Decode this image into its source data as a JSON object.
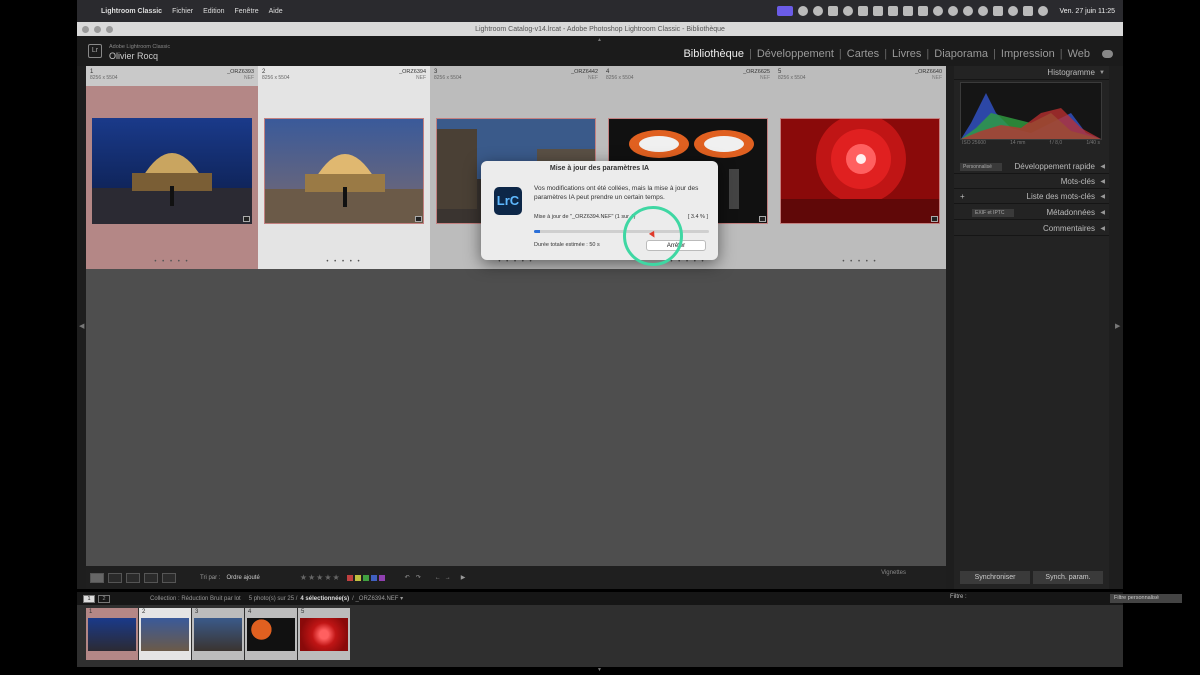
{
  "menubar": {
    "app_name": "Lightroom Classic",
    "menus": [
      "Fichier",
      "Edition",
      "Fenêtre",
      "Aide"
    ],
    "clock": "Ven. 27 juin 11:25"
  },
  "window": {
    "title": "Lightroom Catalog-v14.lrcat - Adobe Photoshop Lightroom Classic - Bibliothèque"
  },
  "header": {
    "logo": "Lr",
    "product": "Adobe Lightroom Classic",
    "user": "Olivier Rocq",
    "modules": [
      "Bibliothèque",
      "Développement",
      "Cartes",
      "Livres",
      "Diaporama",
      "Impression",
      "Web"
    ],
    "active_module": "Bibliothèque"
  },
  "grid": {
    "cells": [
      {
        "index": "1",
        "dims": "8256 x 5504",
        "filename": "_ORZ6393",
        "ext": "NEF",
        "dots": "• • • • •"
      },
      {
        "index": "2",
        "dims": "8256 x 5504",
        "filename": "_ORZ6394",
        "ext": "NEF",
        "dots": "• • • • •"
      },
      {
        "index": "3",
        "dims": "8256 x 5504",
        "filename": "_ORZ6442",
        "ext": "NEF",
        "dots": "• • • • •"
      },
      {
        "index": "4",
        "dims": "8256 x 5504",
        "filename": "_ORZ6625",
        "ext": "NEF",
        "dots": "• • • • •"
      },
      {
        "index": "5",
        "dims": "8256 x 5504",
        "filename": "_ORZ6640",
        "ext": "NEF",
        "dots": "• • • • •"
      }
    ]
  },
  "dialog": {
    "title": "Mise à jour des paramètres IA",
    "logo": "LrC",
    "message": "Vos modifications ont été collées, mais la mise à jour des paramètres IA peut prendre un certain temps.",
    "progress_label": "Mise à jour de \"_ORZ6394.NEF\" (1 sur 4)",
    "progress_pct": "[ 3.4 % ]",
    "progress_value": 0.034,
    "duration": "Durée totale estimée : 50 s",
    "stop_button": "Arrêter"
  },
  "toolbar": {
    "sort_label": "Tri par :",
    "sort_value": "Ordre ajouté",
    "stars": "★★★★★",
    "vignettes_label": "Vignettes"
  },
  "right_panel": {
    "histogram": "Histogramme",
    "histo_info": [
      "ISO 25600",
      "14 mm",
      "f / 8,0",
      "1/40 s"
    ],
    "quick_dev_preset": "Personnalisé",
    "quick_dev": "Développement rapide",
    "keywords": "Mots-clés",
    "keyword_list": "Liste des mots-clés",
    "metadata_preset": "EXIF et IPTC",
    "metadata": "Métadonnées",
    "comments": "Commentaires",
    "sync_button": "Synchroniser",
    "sync_settings_button": "Synch. param."
  },
  "filmstrip": {
    "pages": [
      "1",
      "2"
    ],
    "collection": "Collection : Réduction Bruit par lot",
    "count": "5 photo(s) sur 25 /",
    "selected": "4 sélectionnée(s)",
    "current": "/ _ORZ6394.NEF ▾",
    "filter_label": "Filtre :",
    "filter_value": "Filtre personnalisé",
    "thumbs": [
      "1",
      "2",
      "3",
      "4",
      "5"
    ]
  },
  "colors": {
    "selected_cell": "#b48786",
    "active_cell": "#e4e4e4",
    "inactive_cell": "#bcbcbc",
    "dialog_bg": "#ececec",
    "progress": "#2b6fd8",
    "highlight_ring": "#3fd7a3",
    "menubar_active": "#6b5ce7"
  }
}
